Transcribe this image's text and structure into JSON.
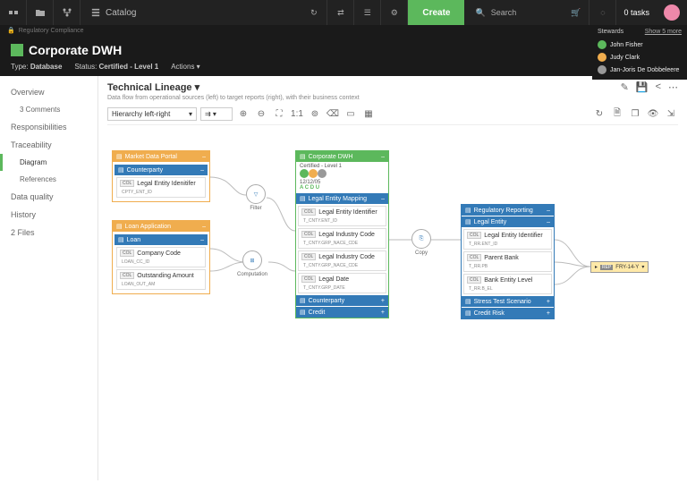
{
  "topnav": {
    "catalog": "Catalog",
    "create": "Create",
    "search_placeholder": "Search",
    "tasks": "0  tasks"
  },
  "breadcrumb": "Regulatory Compliance",
  "stewards": {
    "label": "Stewards",
    "show_more": "Show 5 more",
    "people": [
      {
        "name": "John Fisher",
        "color": "#5cb85c"
      },
      {
        "name": "Judy Clark",
        "color": "#f0ad4e"
      },
      {
        "name": "Jan-Joris De Dobbeleere",
        "color": "#999"
      }
    ]
  },
  "header": {
    "title": "Corporate DWH",
    "type_label": "Type:",
    "type": "Database",
    "status_label": "Status:",
    "status": "Certified - Level 1",
    "actions": "Actions",
    "more": "More"
  },
  "sidebar": [
    {
      "label": "Overview",
      "indent": false
    },
    {
      "label": "3 Comments",
      "indent": true
    },
    {
      "label": "Responsibilities",
      "indent": false
    },
    {
      "label": "Traceability",
      "indent": false
    },
    {
      "label": "Diagram",
      "indent": true,
      "active": true
    },
    {
      "label": "References",
      "indent": true
    },
    {
      "label": "Data quality",
      "indent": false
    },
    {
      "label": "History",
      "indent": false
    },
    {
      "label": "2 Files",
      "indent": false
    }
  ],
  "content": {
    "title": "Technical Lineage",
    "subtitle": "Data flow from operational sources (left) to target reports (right), with their business context",
    "hierarchy": "Hierarchy left-right"
  },
  "nodes": {
    "market": {
      "title": "Market Data Portal",
      "sub": "Counterparty",
      "field_tag": "COL",
      "field": "Legal Entity Idenitifer",
      "field_sub": "CPTY_ENT_ID"
    },
    "loan": {
      "title": "Loan Application",
      "sub": "Loan",
      "f1_tag": "COL",
      "f1": "Company Code",
      "f1_sub": "LOAN_CC_ID",
      "f2_tag": "COL",
      "f2": "Outstanding Amount",
      "f2_sub": "LOAN_OUT_AM"
    },
    "corp": {
      "title": "Corporate DWH",
      "status": "Certified - Level 1",
      "date": "12/12/05",
      "grade": "A C D U",
      "sub1": "Legal Entity Mapping",
      "f1_tag": "COL",
      "f1": "Legal Entity Identifier",
      "f1_sub": "T_CNTY.ENT_ID",
      "f2_tag": "COL",
      "f2": "Legal Industry Code",
      "f2_sub": "T_CNTY.GRP_NACE_CDE",
      "f3_tag": "COL",
      "f3": "Legal Industry Code",
      "f3_sub": "T_CNTY.GRP_NACE_CDE",
      "f4_tag": "COL",
      "f4": "Legal Date",
      "f4_sub": "T_CNTY.GRP_DATE",
      "sub2": "Counterparty",
      "sub3": "Credit"
    },
    "reg": {
      "title": "Regulatory Reporting",
      "sub1": "Legal Entity",
      "f1_tag": "COL",
      "f1": "Legal Entity Identifier",
      "f1_sub": "T_RR.ENT_ID",
      "f2_tag": "COL",
      "f2": "Parent Bank",
      "f2_sub": "T_RR.PB",
      "f3_tag": "COL",
      "f3": "Bank Entity Level",
      "f3_sub": "T_RR.B_EL",
      "sub2": "Stress Test Scenario",
      "sub3": "Credit Risk"
    },
    "filter": "Filter",
    "computation": "Computation",
    "copy": "Copy",
    "ref_tag": "REP",
    "ref": "FRY-14-Y"
  }
}
